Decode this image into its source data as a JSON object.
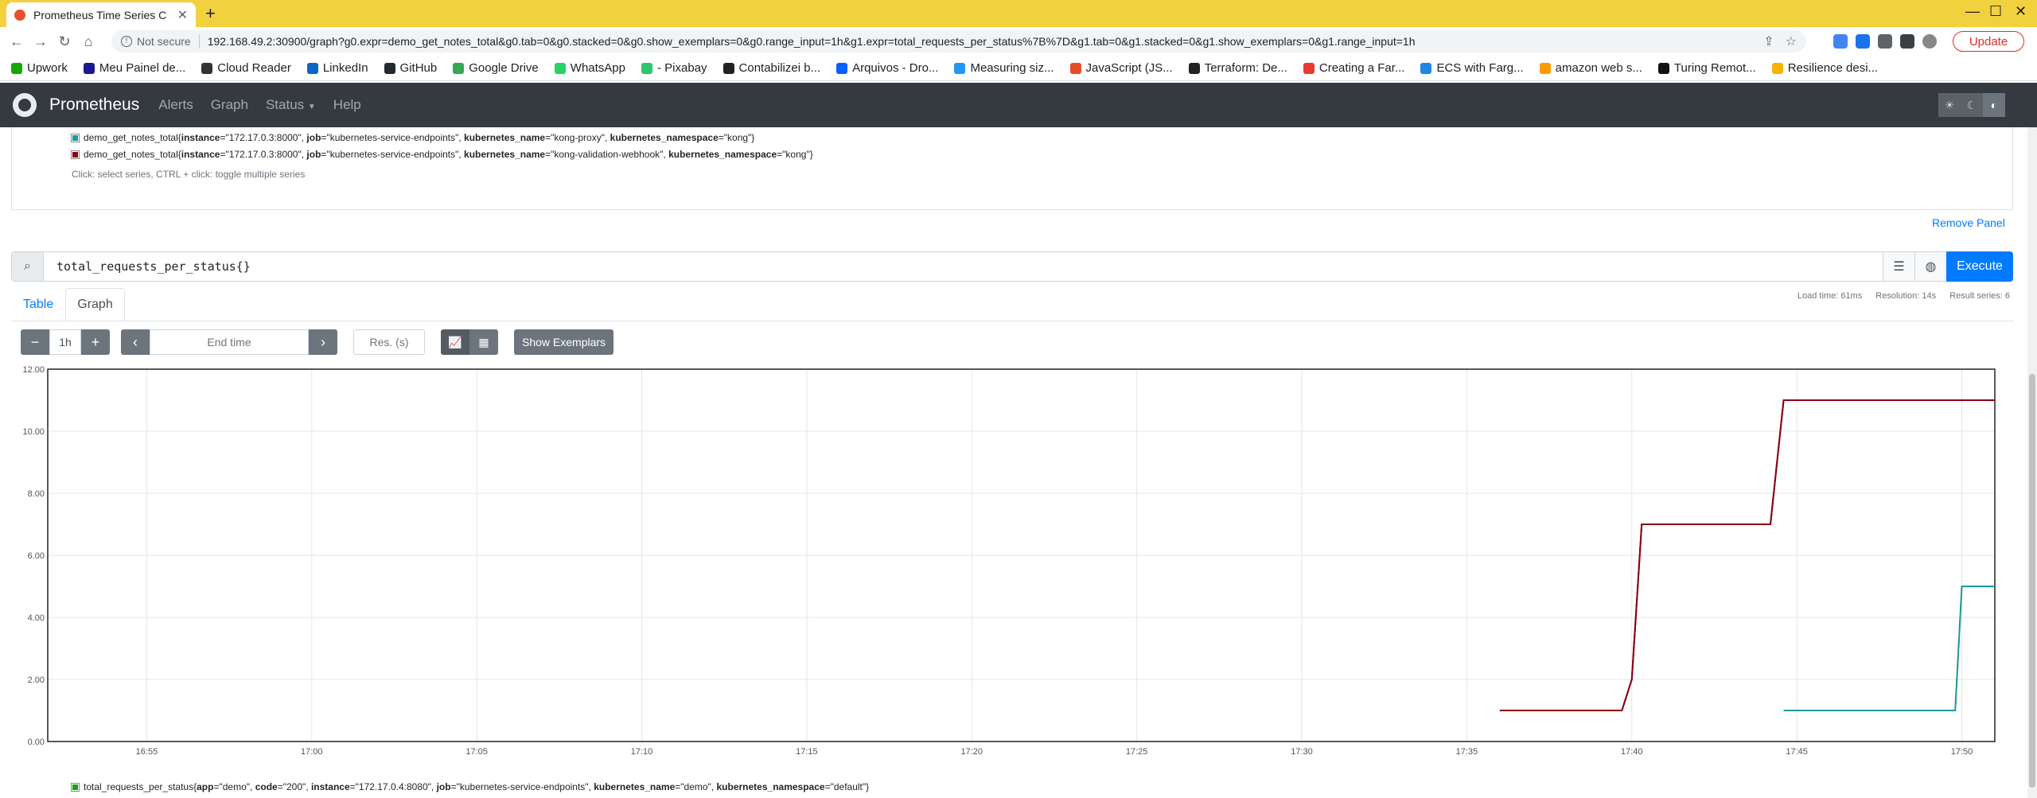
{
  "browser": {
    "tab_title": "Prometheus Time Series C",
    "not_secure": "Not secure",
    "url": "192.168.49.2:30900/graph?g0.expr=demo_get_notes_total&g0.tab=0&g0.stacked=0&g0.show_exemplars=0&g0.range_input=1h&g1.expr=total_requests_per_status%7B%7D&g1.tab=0&g1.stacked=0&g1.show_exemplars=0&g1.range_input=1h",
    "update_label": "Update",
    "bookmarks": [
      {
        "label": "Upwork",
        "color": "#14a800"
      },
      {
        "label": "Meu Painel de...",
        "color": "#1a1a8f"
      },
      {
        "label": "Cloud Reader",
        "color": "#333333"
      },
      {
        "label": "LinkedIn",
        "color": "#0a66c2"
      },
      {
        "label": "GitHub",
        "color": "#24292e"
      },
      {
        "label": "Google Drive",
        "color": "#34a853"
      },
      {
        "label": "WhatsApp",
        "color": "#25d366"
      },
      {
        "label": "- Pixabay",
        "color": "#2ec66d"
      },
      {
        "label": "Contabilizei b...",
        "color": "#222222"
      },
      {
        "label": "Arquivos - Dro...",
        "color": "#0061ff"
      },
      {
        "label": "Measuring siz...",
        "color": "#2196f3"
      },
      {
        "label": "JavaScript (JS...",
        "color": "#e44d26"
      },
      {
        "label": "Terraform: De...",
        "color": "#222222"
      },
      {
        "label": "Creating a Far...",
        "color": "#e63c2f"
      },
      {
        "label": "ECS with Farg...",
        "color": "#1e88e5"
      },
      {
        "label": "amazon web s...",
        "color": "#ff9900"
      },
      {
        "label": "Turing Remot...",
        "color": "#111111"
      },
      {
        "label": "Resilience desi...",
        "color": "#f4b400"
      }
    ]
  },
  "nav": {
    "brand": "Prometheus",
    "links": [
      "Alerts",
      "Graph",
      "Status",
      "Help"
    ]
  },
  "panel1": {
    "legend": [
      {
        "metric": "demo_get_notes_total{",
        "instance": "\"172.17.0.3:8000\"",
        "job": "\"kubernetes-service-endpoints\"",
        "kname": "\"kong-proxy\"",
        "kns": "\"kong\"}",
        "color": "#1a9aa0"
      },
      {
        "metric": "demo_get_notes_total{",
        "instance": "\"172.17.0.3:8000\"",
        "job": "\"kubernetes-service-endpoints\"",
        "kname": "\"kong-validation-webhook\"",
        "kns": "\"kong\"}",
        "color": "#8b0015"
      }
    ],
    "keys": {
      "instance": "instance",
      "job": "job",
      "kname": "kubernetes_name",
      "kns": "kubernetes_namespace"
    },
    "hint": "Click: select series, CTRL + click: toggle multiple series",
    "remove": "Remove Panel"
  },
  "panel2": {
    "expr": "total_requests_per_status{}",
    "execute": "Execute",
    "tabs": [
      "Table",
      "Graph"
    ],
    "stats": {
      "load": "Load time: 61ms",
      "resolution": "Resolution: 14s",
      "series": "Result series: 6"
    },
    "controls": {
      "minus": "−",
      "range": "1h",
      "plus": "+",
      "prev": "‹",
      "end_time_placeholder": "End time",
      "next": "›",
      "res_placeholder": "Res. (s)",
      "exemplars": "Show Exemplars"
    },
    "legend_bottom": {
      "metric": "total_requests_per_status{",
      "app": "\"demo\"",
      "code": "\"200\"",
      "instance": "\"172.17.0.4:8080\"",
      "job": "\"kubernetes-service-endpoints\"",
      "kname": "\"demo\"",
      "kns": "\"default\"}",
      "color": "#19a020"
    },
    "legend_keys": {
      "app": "app",
      "code": "code",
      "instance": "instance",
      "job": "job",
      "kname": "kubernetes_name",
      "kns": "kubernetes_namespace"
    }
  },
  "chart_data": {
    "type": "line",
    "ylim": [
      0,
      12
    ],
    "yticks": [
      "0.00",
      "2.00",
      "4.00",
      "6.00",
      "8.00",
      "10.00",
      "12.00"
    ],
    "xlim": [
      "16:52",
      "17:51"
    ],
    "xticks": [
      "16:55",
      "17:00",
      "17:05",
      "17:10",
      "17:15",
      "17:20",
      "17:25",
      "17:30",
      "17:35",
      "17:40",
      "17:45",
      "17:50"
    ],
    "series": [
      {
        "color": "#9b1b6e",
        "x": [
          "17:36",
          "17:39.7",
          "17:40",
          "17:40.3",
          "17:44.2",
          "17:44.6",
          "17:51"
        ],
        "y": [
          1,
          1,
          2,
          7,
          7,
          11,
          11
        ]
      },
      {
        "color": "#2ea02c",
        "x": [
          "17:36",
          "17:39.7",
          "17:40",
          "17:40.3",
          "17:44.2",
          "17:44.6",
          "17:51"
        ],
        "y": [
          1,
          1,
          2,
          7,
          7,
          11,
          11
        ]
      },
      {
        "color": "#8b0015",
        "x": [
          "17:36",
          "17:39.7",
          "17:40",
          "17:40.3",
          "17:44.2",
          "17:44.6",
          "17:51"
        ],
        "y": [
          1,
          1,
          2,
          7,
          7,
          11,
          11
        ]
      },
      {
        "color": "#c8a000",
        "x": [
          "17:44.6",
          "17:49.8",
          "17:50",
          "17:51"
        ],
        "y": [
          1,
          1,
          5,
          5
        ]
      },
      {
        "color": "#1a9aa0",
        "x": [
          "17:44.6",
          "17:49.8",
          "17:50",
          "17:51"
        ],
        "y": [
          1,
          1,
          5,
          5
        ]
      }
    ]
  }
}
